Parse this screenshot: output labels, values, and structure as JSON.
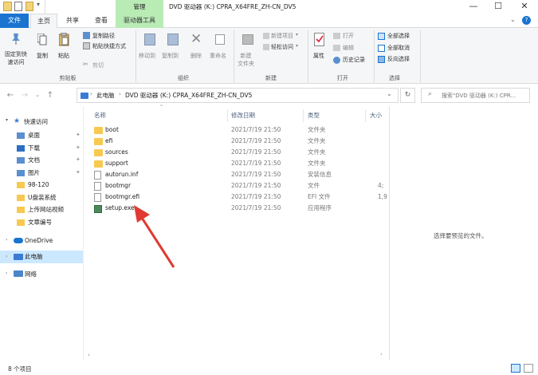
{
  "titlebar": {
    "context_tab": "管理",
    "title": "DVD 驱动器 (K:) CPRA_X64FRE_ZH-CN_DV5",
    "minimize": "—",
    "maximize": "☐",
    "close": "✕"
  },
  "tabs": {
    "file": "文件",
    "home": "主页",
    "share": "共享",
    "view": "查看",
    "drive_tools": "驱动器工具",
    "help": "?"
  },
  "ribbon": {
    "pin_label": "固定到快\n速访问",
    "copy_label": "复制",
    "paste_label": "粘贴",
    "copy_path": "复制路径",
    "paste_shortcut": "粘贴快捷方式",
    "cut": "剪切",
    "move_to": "移动到",
    "copy_to": "复制到",
    "delete": "删除",
    "rename": "重命名",
    "new_folder": "新建\n文件夹",
    "new_item": "新建项目",
    "easy_access": "轻松访问",
    "properties": "属性",
    "open": "打开",
    "edit": "编辑",
    "history": "历史记录",
    "select_all": "全部选择",
    "select_none": "全部取消",
    "invert_select": "反向选择",
    "groups": {
      "clipboard": "剪贴板",
      "organize": "组织",
      "new": "新建",
      "open": "打开",
      "select": "选择"
    }
  },
  "address": {
    "path_root": "此电脑",
    "path_drive": "DVD 驱动器 (K:) CPRA_X64FRE_ZH-CN_DV5",
    "search_placeholder": "搜索\"DVD 驱动器 (K:) CPR..."
  },
  "nav": {
    "quick_access": "快速访问",
    "items": [
      {
        "label": "桌面",
        "pinned": true,
        "icon": "desktop-icon"
      },
      {
        "label": "下载",
        "pinned": true,
        "icon": "download-icon"
      },
      {
        "label": "文档",
        "pinned": true,
        "icon": "document-icon"
      },
      {
        "label": "图片",
        "pinned": true,
        "icon": "picture-icon"
      },
      {
        "label": "98-120",
        "pinned": false,
        "icon": "folder-icon"
      },
      {
        "label": "U盘装系统",
        "pinned": false,
        "icon": "folder-icon"
      },
      {
        "label": "上传网站视频",
        "pinned": false,
        "icon": "folder-icon"
      },
      {
        "label": "文章编号",
        "pinned": false,
        "icon": "folder-icon"
      }
    ],
    "onedrive": "OneDrive",
    "this_pc": "此电脑",
    "network": "网络"
  },
  "columns": {
    "name": "名称",
    "modified": "修改日期",
    "type": "类型",
    "size": "大小"
  },
  "files": [
    {
      "name": "boot",
      "date": "2021/7/19 21:50",
      "type": "文件夹",
      "size": "",
      "kind": "folder"
    },
    {
      "name": "efi",
      "date": "2021/7/19 21:50",
      "type": "文件夹",
      "size": "",
      "kind": "folder"
    },
    {
      "name": "sources",
      "date": "2021/7/19 21:50",
      "type": "文件夹",
      "size": "",
      "kind": "folder"
    },
    {
      "name": "support",
      "date": "2021/7/19 21:50",
      "type": "文件夹",
      "size": "",
      "kind": "folder"
    },
    {
      "name": "autorun.inf",
      "date": "2021/7/19 21:50",
      "type": "安装信息",
      "size": "",
      "kind": "inf"
    },
    {
      "name": "bootmgr",
      "date": "2021/7/19 21:50",
      "type": "文件",
      "size": "4;",
      "kind": "file"
    },
    {
      "name": "bootmgr.efi",
      "date": "2021/7/19 21:50",
      "type": "EFI 文件",
      "size": "1,9",
      "kind": "file"
    },
    {
      "name": "setup.exe",
      "date": "2021/7/19 21:50",
      "type": "应用程序",
      "size": "",
      "kind": "exe"
    }
  ],
  "preview": {
    "message": "选择要预览的文件。"
  },
  "status": {
    "count": "8 个项目"
  },
  "colors": {
    "accent": "#1a74d0",
    "context_tab": "#b9ebb5",
    "folder": "#f7c951",
    "arrow": "#e03b32",
    "selected": "#cce8ff"
  }
}
